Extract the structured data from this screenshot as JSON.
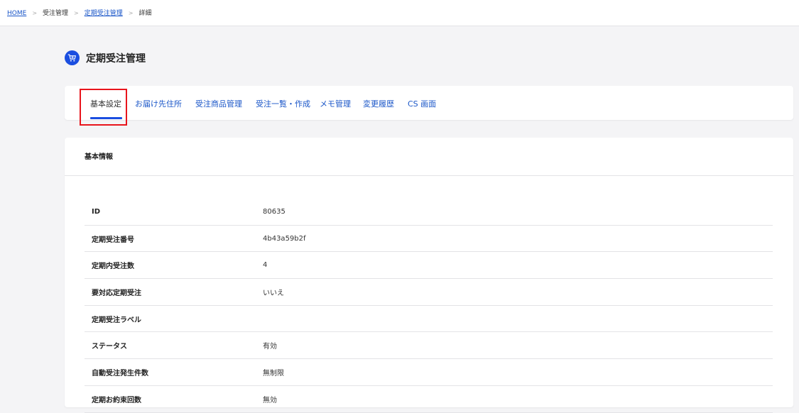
{
  "breadcrumb": {
    "home": "HOME",
    "order_mgmt": "受注管理",
    "subscription_mgmt": "定期受注管理",
    "detail": "詳細",
    "separator": ">"
  },
  "page": {
    "title": "定期受注管理",
    "icon": "cart-icon",
    "accent_color": "#1b4ee0",
    "link_color": "#1a56c8",
    "highlight_color": "#e8141c"
  },
  "tabs": [
    {
      "label": "基本設定",
      "active": true
    },
    {
      "label": "お届け先住所",
      "active": false
    },
    {
      "label": "受注商品管理",
      "active": false
    },
    {
      "label": "受注一覧・作成",
      "active": false
    },
    {
      "label": "メモ管理",
      "active": false
    },
    {
      "label": "変更履歴",
      "active": false
    },
    {
      "label": "CS 画面",
      "active": false
    }
  ],
  "info": {
    "header": "基本情報",
    "rows": [
      {
        "label": "ID",
        "value": "80635"
      },
      {
        "label": "定期受注番号",
        "value": "4b43a59b2f"
      },
      {
        "label": "定期内受注数",
        "value": "4"
      },
      {
        "label": "要対応定期受注",
        "value": "いいえ"
      },
      {
        "label": "定期受注ラベル",
        "value": ""
      },
      {
        "label": "ステータス",
        "value": "有効"
      },
      {
        "label": "自動受注発生件数",
        "value": "無制限"
      },
      {
        "label": "定期お約束回数",
        "value": "無効"
      }
    ]
  }
}
